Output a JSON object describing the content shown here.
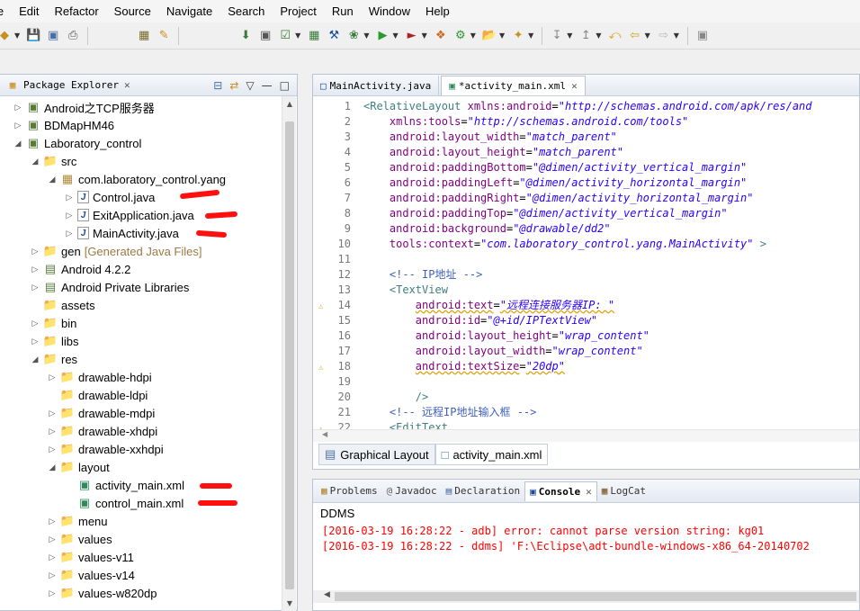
{
  "menu": [
    "le",
    "Edit",
    "Refactor",
    "Source",
    "Navigate",
    "Search",
    "Project",
    "Run",
    "Window",
    "Help"
  ],
  "package_explorer": {
    "title": "Package Explorer",
    "tree": [
      {
        "label": "Android之TCP服务器",
        "suffix": "",
        "depth": 0,
        "expand": "closed",
        "icon": "android-project-icon"
      },
      {
        "label": "BDMapHM46",
        "suffix": "",
        "depth": 0,
        "expand": "closed",
        "icon": "android-project-icon"
      },
      {
        "label": "Laboratory_control",
        "suffix": "",
        "depth": 0,
        "expand": "open",
        "icon": "android-project-icon"
      },
      {
        "label": "src",
        "suffix": "",
        "depth": 1,
        "expand": "open",
        "icon": "source-folder-icon"
      },
      {
        "label": "com.laboratory_control.yang",
        "suffix": "",
        "depth": 2,
        "expand": "open",
        "icon": "package-icon"
      },
      {
        "label": "Control.java",
        "suffix": "",
        "depth": 3,
        "expand": "closed",
        "icon": "java-file-icon"
      },
      {
        "label": "ExitApplication.java",
        "suffix": "",
        "depth": 3,
        "expand": "closed",
        "icon": "java-file-icon"
      },
      {
        "label": "MainActivity.java",
        "suffix": "",
        "depth": 3,
        "expand": "closed",
        "icon": "java-file-icon"
      },
      {
        "label": "gen",
        "suffix": "[Generated Java Files]",
        "depth": 1,
        "expand": "closed",
        "icon": "source-folder-icon"
      },
      {
        "label": "Android 4.2.2",
        "suffix": "",
        "depth": 1,
        "expand": "closed",
        "icon": "library-icon"
      },
      {
        "label": "Android Private Libraries",
        "suffix": "",
        "depth": 1,
        "expand": "closed",
        "icon": "library-icon"
      },
      {
        "label": "assets",
        "suffix": "",
        "depth": 1,
        "expand": "none",
        "icon": "folder-icon"
      },
      {
        "label": "bin",
        "suffix": "",
        "depth": 1,
        "expand": "closed",
        "icon": "folder-icon"
      },
      {
        "label": "libs",
        "suffix": "",
        "depth": 1,
        "expand": "closed",
        "icon": "folder-icon"
      },
      {
        "label": "res",
        "suffix": "",
        "depth": 1,
        "expand": "open",
        "icon": "folder-icon"
      },
      {
        "label": "drawable-hdpi",
        "suffix": "",
        "depth": 2,
        "expand": "closed",
        "icon": "folder-icon"
      },
      {
        "label": "drawable-ldpi",
        "suffix": "",
        "depth": 2,
        "expand": "none",
        "icon": "folder-icon"
      },
      {
        "label": "drawable-mdpi",
        "suffix": "",
        "depth": 2,
        "expand": "closed",
        "icon": "folder-icon"
      },
      {
        "label": "drawable-xhdpi",
        "suffix": "",
        "depth": 2,
        "expand": "closed",
        "icon": "folder-icon"
      },
      {
        "label": "drawable-xxhdpi",
        "suffix": "",
        "depth": 2,
        "expand": "closed",
        "icon": "folder-icon"
      },
      {
        "label": "layout",
        "suffix": "",
        "depth": 2,
        "expand": "open",
        "icon": "folder-icon"
      },
      {
        "label": "activity_main.xml",
        "suffix": "",
        "depth": 3,
        "expand": "none",
        "icon": "xml-file-icon"
      },
      {
        "label": "control_main.xml",
        "suffix": "",
        "depth": 3,
        "expand": "none",
        "icon": "xml-file-icon"
      },
      {
        "label": "menu",
        "suffix": "",
        "depth": 2,
        "expand": "closed",
        "icon": "folder-icon"
      },
      {
        "label": "values",
        "suffix": "",
        "depth": 2,
        "expand": "closed",
        "icon": "folder-icon"
      },
      {
        "label": "values-v11",
        "suffix": "",
        "depth": 2,
        "expand": "closed",
        "icon": "folder-icon"
      },
      {
        "label": "values-v14",
        "suffix": "",
        "depth": 2,
        "expand": "closed",
        "icon": "folder-icon"
      },
      {
        "label": "values-w820dp",
        "suffix": "",
        "depth": 2,
        "expand": "closed",
        "icon": "folder-icon"
      }
    ]
  },
  "editor": {
    "tabs": [
      {
        "label": "MainActivity.java",
        "active": false
      },
      {
        "label": "*activity_main.xml",
        "active": true
      }
    ],
    "lines": [
      {
        "n": "1",
        "warn": false,
        "parts": [
          [
            "tag",
            "<RelativeLayout "
          ],
          [
            "attr",
            "xmlns:android"
          ],
          [
            "plain",
            "="
          ],
          [
            "val",
            "\"http://schemas.android.com/apk/res/and"
          ]
        ]
      },
      {
        "n": "2",
        "warn": false,
        "parts": [
          [
            "plain",
            "    "
          ],
          [
            "attr",
            "xmlns:tools"
          ],
          [
            "plain",
            "="
          ],
          [
            "val",
            "\"http://schemas.android.com/tools\""
          ]
        ]
      },
      {
        "n": "3",
        "warn": false,
        "parts": [
          [
            "plain",
            "    "
          ],
          [
            "attr",
            "android:layout_width"
          ],
          [
            "plain",
            "="
          ],
          [
            "val",
            "\"match_parent\""
          ]
        ]
      },
      {
        "n": "4",
        "warn": false,
        "parts": [
          [
            "plain",
            "    "
          ],
          [
            "attr",
            "android:layout_height"
          ],
          [
            "plain",
            "="
          ],
          [
            "val",
            "\"match_parent\""
          ]
        ]
      },
      {
        "n": "5",
        "warn": false,
        "parts": [
          [
            "plain",
            "    "
          ],
          [
            "attr",
            "android:paddingBottom"
          ],
          [
            "plain",
            "="
          ],
          [
            "val",
            "\"@dimen/activity_vertical_margin\""
          ]
        ]
      },
      {
        "n": "6",
        "warn": false,
        "parts": [
          [
            "plain",
            "    "
          ],
          [
            "attr",
            "android:paddingLeft"
          ],
          [
            "plain",
            "="
          ],
          [
            "val",
            "\"@dimen/activity_horizontal_margin\""
          ]
        ]
      },
      {
        "n": "7",
        "warn": false,
        "parts": [
          [
            "plain",
            "    "
          ],
          [
            "attr",
            "android:paddingRight"
          ],
          [
            "plain",
            "="
          ],
          [
            "val",
            "\"@dimen/activity_horizontal_margin\""
          ]
        ]
      },
      {
        "n": "8",
        "warn": false,
        "parts": [
          [
            "plain",
            "    "
          ],
          [
            "attr",
            "android:paddingTop"
          ],
          [
            "plain",
            "="
          ],
          [
            "val",
            "\"@dimen/activity_vertical_margin\""
          ]
        ]
      },
      {
        "n": "9",
        "warn": false,
        "parts": [
          [
            "plain",
            "    "
          ],
          [
            "attr",
            "android:background"
          ],
          [
            "plain",
            "="
          ],
          [
            "val",
            "\"@drawable/dd2\""
          ]
        ]
      },
      {
        "n": "10",
        "warn": false,
        "parts": [
          [
            "plain",
            "    "
          ],
          [
            "attr",
            "tools:context"
          ],
          [
            "plain",
            "="
          ],
          [
            "val",
            "\"com.laboratory_control.yang.MainActivity\""
          ],
          [
            "tag",
            " >"
          ]
        ]
      },
      {
        "n": "11",
        "warn": false,
        "parts": []
      },
      {
        "n": "12",
        "warn": false,
        "parts": [
          [
            "plain",
            "    "
          ],
          [
            "cmt",
            "<!-- IP地址 -->"
          ]
        ]
      },
      {
        "n": "13",
        "warn": false,
        "parts": [
          [
            "plain",
            "    "
          ],
          [
            "tag",
            "<TextView"
          ]
        ]
      },
      {
        "n": "14",
        "warn": true,
        "parts": [
          [
            "plain",
            "        "
          ],
          [
            "attr",
            "android:text"
          ],
          [
            "plain",
            "="
          ],
          [
            "val",
            "\"远程连接服务器IP: \""
          ]
        ]
      },
      {
        "n": "15",
        "warn": false,
        "parts": [
          [
            "plain",
            "        "
          ],
          [
            "attr",
            "android:id"
          ],
          [
            "plain",
            "="
          ],
          [
            "val",
            "\"@+id/IPTextView\""
          ]
        ]
      },
      {
        "n": "16",
        "warn": false,
        "parts": [
          [
            "plain",
            "        "
          ],
          [
            "attr",
            "android:layout_height"
          ],
          [
            "plain",
            "="
          ],
          [
            "val",
            "\"wrap_content\""
          ]
        ]
      },
      {
        "n": "17",
        "warn": false,
        "parts": [
          [
            "plain",
            "        "
          ],
          [
            "attr",
            "android:layout_width"
          ],
          [
            "plain",
            "="
          ],
          [
            "val",
            "\"wrap_content\""
          ]
        ]
      },
      {
        "n": "18",
        "warn": true,
        "parts": [
          [
            "plain",
            "        "
          ],
          [
            "attr",
            "android:textSize"
          ],
          [
            "plain",
            "="
          ],
          [
            "val",
            "\"20dp\""
          ]
        ]
      },
      {
        "n": "19",
        "warn": false,
        "parts": []
      },
      {
        "n": "20",
        "warn": false,
        "parts": [
          [
            "plain",
            "        "
          ],
          [
            "tag",
            "/>"
          ]
        ]
      },
      {
        "n": "21",
        "warn": false,
        "parts": [
          [
            "plain",
            "    "
          ],
          [
            "cmt",
            "<!-- 远程IP地址输入框 -->"
          ]
        ]
      },
      {
        "n": "22",
        "warn": true,
        "parts": [
          [
            "plain",
            "    "
          ],
          [
            "tag",
            "<EditText"
          ]
        ]
      }
    ],
    "bottom_tabs": [
      {
        "label": "Graphical Layout",
        "active": false
      },
      {
        "label": "activity_main.xml",
        "active": true
      }
    ]
  },
  "console": {
    "tabs": [
      {
        "label": "Problems",
        "icon": "problems-icon",
        "active": false
      },
      {
        "label": "Javadoc",
        "icon": "javadoc-icon",
        "active": false
      },
      {
        "label": "Declaration",
        "icon": "declaration-icon",
        "active": false
      },
      {
        "label": "Console",
        "icon": "console-icon",
        "active": true
      },
      {
        "label": "LogCat",
        "icon": "logcat-icon",
        "active": false
      }
    ],
    "title": "DDMS",
    "lines": [
      "[2016-03-19 16:28:22 - adb] error: cannot parse version string: kg01",
      "[2016-03-19 16:28:22 - ddms] 'F:\\Eclipse\\adt-bundle-windows-x86_64-20140702"
    ]
  },
  "colors": {
    "highlight_marks": "#ff1010",
    "error_text": "#ff0000"
  }
}
